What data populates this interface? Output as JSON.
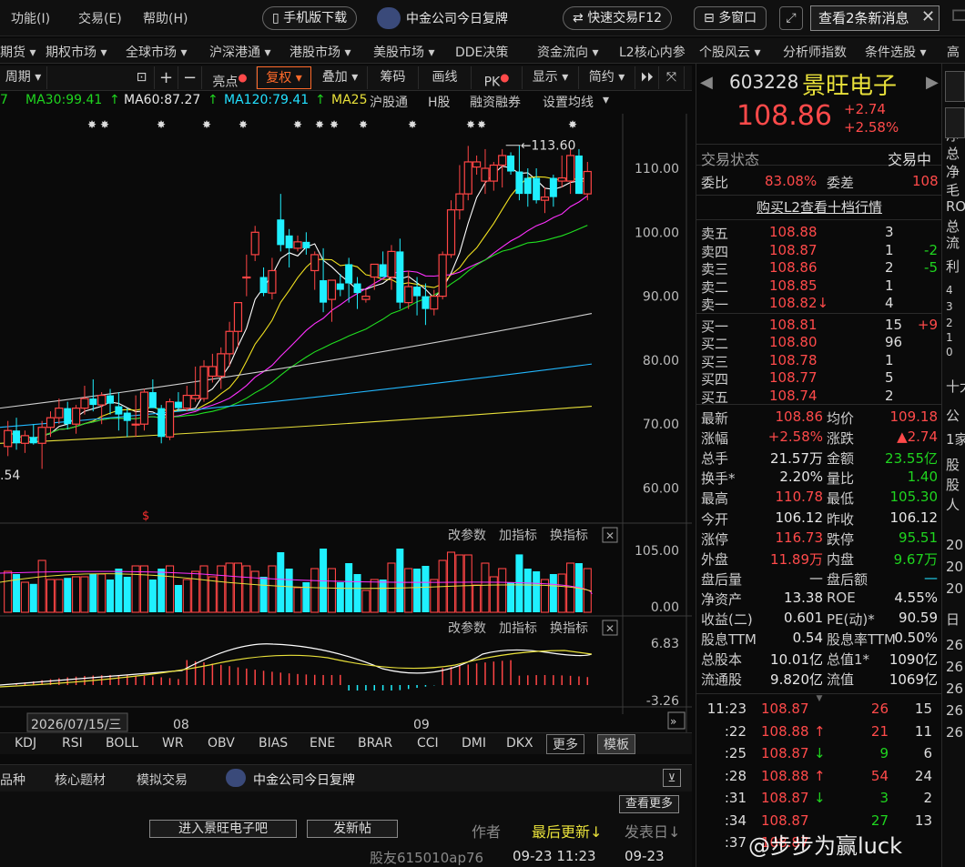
{
  "menu": {
    "items": [
      "功能(I)",
      "交易(E)",
      "帮助(H)"
    ],
    "mobile_download": "手机版下载",
    "news": "中金公司今日复牌",
    "quick_trade": "快速交易F12",
    "multi_window": "多窗口",
    "new_msgs": "查看2条新消息"
  },
  "nav": [
    "期货",
    "期权市场",
    "全球市场",
    "沪深港通",
    "港股市场",
    "美股市场",
    "DDE决策",
    "资金流向",
    "L2核心内参",
    "个股风云",
    "分析师指数",
    "条件选股",
    "高"
  ],
  "toolbar": {
    "period": "周期",
    "items": [
      "亮点",
      "复权",
      "叠加",
      "筹码",
      "画线",
      "PK",
      "显示",
      "简约"
    ]
  },
  "ma": {
    "ma_prev": "7",
    "ma30": "MA30:99.41",
    "ma60": "MA60:87.27",
    "ma120": "MA120:79.41",
    "ma250": "MA25",
    "links": [
      "沪股通",
      "H股",
      "融资融券",
      "设置均线"
    ]
  },
  "chart_data": {
    "type": "candlestick",
    "y_ticks": [
      "110.00",
      "100.00",
      "90.00",
      "80.00",
      "70.00",
      "60.00"
    ],
    "high_label": "113.60",
    "low_label": ".54",
    "vol_ticks": [
      "105.00",
      "0.00"
    ],
    "macd_ticks": [
      "6.83",
      "-3.26"
    ],
    "x_labels": [
      "2026/07/15/三",
      "08",
      "09"
    ],
    "panel_tools": [
      "改参数",
      "加指标",
      "换指标"
    ],
    "candles": [
      {
        "o": 66.5,
        "h": 70.5,
        "l": 65,
        "c": 69,
        "r": 0
      },
      {
        "o": 69,
        "h": 71,
        "l": 66,
        "c": 67,
        "r": 1
      },
      {
        "o": 67,
        "h": 69,
        "l": 65.5,
        "c": 68.2,
        "r": 0
      },
      {
        "o": 68,
        "h": 70,
        "l": 66.8,
        "c": 67,
        "r": 1
      },
      {
        "o": 67,
        "h": 70.5,
        "l": 63,
        "c": 69.5,
        "r": 0
      },
      {
        "o": 69.5,
        "h": 72,
        "l": 68,
        "c": 71,
        "r": 0
      },
      {
        "o": 71,
        "h": 74,
        "l": 70,
        "c": 72.5,
        "r": 0
      },
      {
        "o": 72.5,
        "h": 73.5,
        "l": 69.2,
        "c": 70,
        "r": 1
      },
      {
        "o": 70,
        "h": 73,
        "l": 68.5,
        "c": 72.5,
        "r": 0
      },
      {
        "o": 72.5,
        "h": 76,
        "l": 71.5,
        "c": 74,
        "r": 0
      },
      {
        "o": 74,
        "h": 77,
        "l": 72,
        "c": 73,
        "r": 1
      },
      {
        "o": 73,
        "h": 75,
        "l": 70,
        "c": 74.5,
        "r": 0
      },
      {
        "o": 74.5,
        "h": 75.5,
        "l": 71.5,
        "c": 73.2,
        "r": 1
      },
      {
        "o": 72.8,
        "h": 75,
        "l": 69,
        "c": 71.5,
        "r": 1
      },
      {
        "o": 71.8,
        "h": 72.5,
        "l": 68,
        "c": 70.5,
        "r": 1
      },
      {
        "o": 70,
        "h": 74.5,
        "l": 68,
        "c": 70,
        "r": 0
      },
      {
        "o": 70,
        "h": 75.5,
        "l": 69,
        "c": 75,
        "r": 0
      },
      {
        "o": 75,
        "h": 77,
        "l": 73,
        "c": 72.5,
        "r": 1
      },
      {
        "o": 72.5,
        "h": 73,
        "l": 67,
        "c": 68,
        "r": 1
      },
      {
        "o": 68,
        "h": 74,
        "l": 67.5,
        "c": 73.5,
        "r": 0
      },
      {
        "o": 73.5,
        "h": 75,
        "l": 72,
        "c": 72.5,
        "r": 1
      },
      {
        "o": 72.5,
        "h": 76,
        "l": 72,
        "c": 74.5,
        "r": 0
      },
      {
        "o": 74.5,
        "h": 79,
        "l": 73.5,
        "c": 74,
        "r": 0
      },
      {
        "o": 74,
        "h": 80,
        "l": 73.5,
        "c": 79,
        "r": 0
      },
      {
        "o": 79,
        "h": 81,
        "l": 76.5,
        "c": 77.5,
        "r": 0
      },
      {
        "o": 77.5,
        "h": 82,
        "l": 75.5,
        "c": 81,
        "r": 0
      },
      {
        "o": 81,
        "h": 86,
        "l": 79,
        "c": 84.5,
        "r": 0
      },
      {
        "o": 84.5,
        "h": 89,
        "l": 82,
        "c": 89,
        "r": 0
      },
      {
        "o": 93,
        "h": 96.5,
        "l": 90,
        "c": 93,
        "r": 0
      },
      {
        "o": 96.5,
        "h": 101,
        "l": 95.5,
        "c": 100,
        "r": 0
      },
      {
        "o": 93,
        "h": 94.5,
        "l": 90,
        "c": 90.5,
        "r": 1
      },
      {
        "o": 90.5,
        "h": 96,
        "l": 89.5,
        "c": 94,
        "r": 0
      },
      {
        "o": 98,
        "h": 106,
        "l": 97,
        "c": 102,
        "r": 1
      },
      {
        "o": 99.5,
        "h": 100.5,
        "l": 94.5,
        "c": 97.5,
        "r": 1
      },
      {
        "o": 98.5,
        "h": 99.5,
        "l": 97,
        "c": 97.5,
        "r": 0
      },
      {
        "o": 98.5,
        "h": 100,
        "l": 96.5,
        "c": 97.5,
        "r": 1
      },
      {
        "o": 94,
        "h": 97,
        "l": 91,
        "c": 96.5,
        "r": 0
      },
      {
        "o": 92.5,
        "h": 97.5,
        "l": 87.5,
        "c": 89,
        "r": 1
      },
      {
        "o": 89.5,
        "h": 92,
        "l": 86,
        "c": 92.5,
        "r": 0
      },
      {
        "o": 92,
        "h": 93.5,
        "l": 90,
        "c": 91,
        "r": 1
      },
      {
        "o": 95,
        "h": 96,
        "l": 89,
        "c": 92,
        "r": 1
      },
      {
        "o": 92,
        "h": 93,
        "l": 88,
        "c": 90.5,
        "r": 1
      },
      {
        "o": 90,
        "h": 91,
        "l": 89,
        "c": 89.5,
        "r": 0
      },
      {
        "o": 93,
        "h": 95,
        "l": 91,
        "c": 95,
        "r": 0
      },
      {
        "o": 95,
        "h": 97,
        "l": 93,
        "c": 93,
        "r": 1
      },
      {
        "o": 93,
        "h": 98,
        "l": 91,
        "c": 97,
        "r": 0
      },
      {
        "o": 97,
        "h": 99,
        "l": 88,
        "c": 89,
        "r": 1
      },
      {
        "o": 89,
        "h": 94,
        "l": 88,
        "c": 91.5,
        "r": 0
      },
      {
        "o": 91.5,
        "h": 93,
        "l": 87,
        "c": 90,
        "r": 1
      },
      {
        "o": 90,
        "h": 92,
        "l": 85.5,
        "c": 88,
        "r": 1
      },
      {
        "o": 88,
        "h": 91,
        "l": 87,
        "c": 90,
        "r": 0
      },
      {
        "o": 90,
        "h": 97,
        "l": 89.5,
        "c": 96.5,
        "r": 0
      },
      {
        "o": 96.5,
        "h": 105,
        "l": 96,
        "c": 103.5,
        "r": 0
      },
      {
        "o": 103.5,
        "h": 110.5,
        "l": 102,
        "c": 106,
        "r": 0
      },
      {
        "o": 106,
        "h": 113.5,
        "l": 105,
        "c": 111,
        "r": 0
      },
      {
        "o": 111,
        "h": 112,
        "l": 109,
        "c": 110.2,
        "r": 0
      },
      {
        "o": 110,
        "h": 113,
        "l": 106,
        "c": 108,
        "r": 0
      },
      {
        "o": 108,
        "h": 111,
        "l": 106.5,
        "c": 110.5,
        "r": 0
      },
      {
        "o": 110.5,
        "h": 113,
        "l": 107,
        "c": 112,
        "r": 0
      },
      {
        "o": 112,
        "h": 112.5,
        "l": 109,
        "c": 109.5,
        "r": 1
      },
      {
        "o": 109.5,
        "h": 113.6,
        "l": 105,
        "c": 106,
        "r": 1
      },
      {
        "o": 106,
        "h": 110,
        "l": 104,
        "c": 108.5,
        "r": 1
      },
      {
        "o": 108.5,
        "h": 110,
        "l": 104.5,
        "c": 105,
        "r": 1
      },
      {
        "o": 105,
        "h": 107,
        "l": 103,
        "c": 105.5,
        "r": 0
      },
      {
        "o": 105.5,
        "h": 109,
        "l": 104,
        "c": 108.5,
        "r": 1
      },
      {
        "o": 108.5,
        "h": 112,
        "l": 107,
        "c": 108,
        "r": 0
      },
      {
        "o": 108,
        "h": 113,
        "l": 106,
        "c": 112,
        "r": 0
      },
      {
        "o": 112,
        "h": 113,
        "l": 106,
        "c": 106,
        "r": 1
      },
      {
        "o": 106,
        "h": 111,
        "l": 105,
        "c": 109.5,
        "r": 0
      }
    ]
  },
  "indicators": [
    "KDJ",
    "RSI",
    "BOLL",
    "WR",
    "OBV",
    "BIAS",
    "ENE",
    "BRAR",
    "CCI",
    "DMI",
    "DKX",
    "更多",
    "模板"
  ],
  "bottom_tabs": [
    "品种",
    "核心题材",
    "模拟交易",
    "中金公司今日复牌"
  ],
  "forum": {
    "view_more": "查看更多",
    "enter_bar": "进入景旺电子吧",
    "post": "发新帖",
    "col_author": "作者",
    "col_updated": "最后更新↓",
    "col_posted": "发表日↓",
    "row_user": "股友615010ap76",
    "row_updated": "09-23 11:23",
    "row_posted": "09-23",
    "watermark": "@步步为赢luck"
  },
  "quote": {
    "code": "603228",
    "name": "景旺电子",
    "price": "108.86",
    "chg": "+2.74",
    "pct": "+2.58%",
    "status_label": "交易状态",
    "status": "交易中",
    "wb_label": "委比",
    "wb": "83.08%",
    "wc_label": "委差",
    "wc": "108",
    "l2_link": "购买L2查看十档行情"
  },
  "asks": [
    {
      "l": "卖五",
      "p": "108.88",
      "v": "3",
      "d": ""
    },
    {
      "l": "卖四",
      "p": "108.87",
      "v": "1",
      "d": "-2"
    },
    {
      "l": "卖三",
      "p": "108.86",
      "v": "2",
      "d": "-5"
    },
    {
      "l": "卖二",
      "p": "108.85",
      "v": "1",
      "d": ""
    },
    {
      "l": "卖一",
      "p": "108.82↓",
      "v": "4",
      "d": ""
    }
  ],
  "bids": [
    {
      "l": "买一",
      "p": "108.81",
      "v": "15",
      "d": "+9"
    },
    {
      "l": "买二",
      "p": "108.80",
      "v": "96",
      "d": ""
    },
    {
      "l": "买三",
      "p": "108.78",
      "v": "1",
      "d": ""
    },
    {
      "l": "买四",
      "p": "108.77",
      "v": "5",
      "d": ""
    },
    {
      "l": "买五",
      "p": "108.74",
      "v": "2",
      "d": ""
    }
  ],
  "stats": [
    [
      "最新",
      "108.86",
      "均价",
      "109.18"
    ],
    [
      "涨幅",
      "+2.58%",
      "涨跌",
      "▲2.74"
    ],
    [
      "总手",
      "21.57万",
      "金额",
      "23.55亿"
    ],
    [
      "换手*",
      "2.20%",
      "量比",
      "1.40"
    ],
    [
      "最高",
      "110.78",
      "最低",
      "105.30"
    ],
    [
      "今开",
      "106.12",
      "昨收",
      "106.12"
    ],
    [
      "涨停",
      "116.73",
      "跌停",
      "95.51"
    ],
    [
      "外盘",
      "11.89万",
      "内盘",
      "9.67万"
    ],
    [
      "盘后量",
      "—",
      "盘后额",
      "—"
    ],
    [
      "净资产",
      "13.38",
      "ROE",
      "4.55%"
    ],
    [
      "收益(二)",
      "0.601",
      "PE(动)*",
      "90.59"
    ],
    [
      "股息TTM",
      "0.54",
      "股息率TTM",
      "0.50%"
    ],
    [
      "总股本",
      "10.01亿",
      "总值1*",
      "1090亿"
    ],
    [
      "流通股",
      "9.820亿",
      "流值",
      "1069亿"
    ]
  ],
  "ticks": [
    {
      "t": "11:23",
      "p": "108.87",
      "a": "",
      "v": "26",
      "n": "15"
    },
    {
      "t": ":22",
      "p": "108.88",
      "a": "↑",
      "v": "21",
      "n": "11"
    },
    {
      "t": ":25",
      "p": "108.87",
      "a": "↓",
      "v": "9",
      "n": "6"
    },
    {
      "t": ":28",
      "p": "108.88",
      "a": "↑",
      "v": "54",
      "n": "24"
    },
    {
      "t": ":31",
      "p": "108.87",
      "a": "↓",
      "v": "3",
      "n": "2"
    },
    {
      "t": ":34",
      "p": "108.87",
      "a": "",
      "v": "27",
      "n": "13"
    },
    {
      "t": ":37",
      "p": "108.87",
      "a": "",
      "v": "",
      "n": ""
    }
  ],
  "farright": [
    "收",
    "净",
    "总",
    "净",
    "毛",
    "RO",
    "总",
    "流",
    "利",
    "4",
    "3",
    "2",
    "1",
    "0",
    "十大",
    "公",
    "1家",
    "股",
    "股",
    "人",
    "20",
    "20",
    "20",
    "日",
    "26",
    "26",
    "26",
    "26",
    "26"
  ]
}
